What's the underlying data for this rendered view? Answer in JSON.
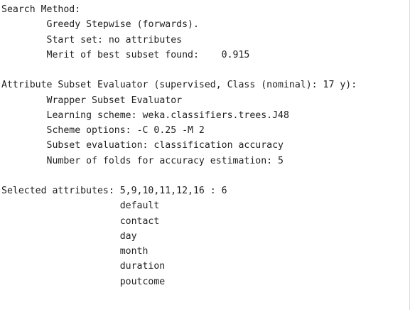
{
  "output": {
    "lines": [
      "Search Method:",
      "\tGreedy Stepwise (forwards).",
      "\tStart set: no attributes",
      "\tMerit of best subset found:    0.915",
      "",
      "Attribute Subset Evaluator (supervised, Class (nominal): 17 y):",
      "\tWrapper Subset Evaluator",
      "\tLearning scheme: weka.classifiers.trees.J48",
      "\tScheme options: -C 0.25 -M 2",
      "\tSubset evaluation: classification accuracy",
      "\tNumber of folds for accuracy estimation: 5",
      "",
      "Selected attributes: 5,9,10,11,12,16 : 6",
      "                     default",
      "                     contact",
      "                     day",
      "                     month",
      "                     duration",
      "                     poutcome"
    ]
  }
}
